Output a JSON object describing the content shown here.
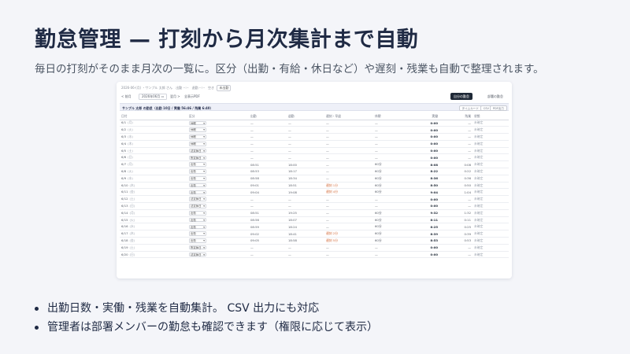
{
  "slide": {
    "title": "勤怠管理 — 打刻から月次集計まで自動",
    "subtitle": "毎日の打刻がそのまま月次の一覧に。区分（出勤・有給・休日など）や遅刻・残業も自動で整理されます。",
    "bullets": [
      "出勤日数・実働・残業を自動集計。 CSV 出力にも対応",
      "管理者は部署メンバーの勤怠も確認できます（権限に応じて表示）"
    ]
  },
  "screen": {
    "crumb": "2026-06-(月) ・サンプル 太郎 さん",
    "crumb_mid": "出勤 --:--　退勤 --:--　空き",
    "crumb_tag": "未出勤",
    "toolbar": {
      "prev": "< 前月",
      "month": "2026年06月",
      "next": "翌月 >",
      "pdf": "全表示PDF",
      "primary_button": "自分の勤怠",
      "secondary_button": "部署の勤怠"
    },
    "summary": {
      "text": "サンプル 太郎 の勤怠（出勤 10日 / 実働 56:46 / 残業 6:40）",
      "pills": [
        "タイムカード",
        "CSV",
        "PDF出力"
      ]
    },
    "columns": [
      "日付",
      "区分",
      "出勤",
      "退勤",
      "遅刻・早退",
      "休憩",
      "実働",
      "残業",
      "状態"
    ],
    "rows": [
      {
        "date": "6/1",
        "dow": "(月)",
        "kubun": "休暇",
        "in": "—",
        "out": "—",
        "pen": "—",
        "brk": "—",
        "work": "0:00",
        "ot": "—",
        "status": "未確定"
      },
      {
        "date": "6/2",
        "dow": "(火)",
        "kubun": "休暇",
        "in": "—",
        "out": "—",
        "pen": "—",
        "brk": "—",
        "work": "0:00",
        "ot": "—",
        "status": "未確定"
      },
      {
        "date": "6/3",
        "dow": "(水)",
        "kubun": "休暇",
        "in": "—",
        "out": "—",
        "pen": "—",
        "brk": "—",
        "work": "0:00",
        "ot": "—",
        "status": "未確定"
      },
      {
        "date": "6/4",
        "dow": "(木)",
        "kubun": "休暇",
        "in": "—",
        "out": "—",
        "pen": "—",
        "brk": "—",
        "work": "0:00",
        "ot": "—",
        "status": "未確定"
      },
      {
        "date": "6/5",
        "dow": "(土)",
        "kubun": "法定休日",
        "in": "—",
        "out": "—",
        "pen": "—",
        "brk": "—",
        "work": "0:00",
        "ot": "—",
        "status": "未確定"
      },
      {
        "date": "6/6",
        "dow": "(日)",
        "kubun": "所定休日",
        "in": "—",
        "out": "—",
        "pen": "—",
        "brk": "—",
        "work": "0:00",
        "ot": "—",
        "status": "未確定"
      },
      {
        "date": "6/7",
        "dow": "(月)",
        "kubun": "出勤",
        "in": "08:51",
        "out": "18:00",
        "pen": "—",
        "brk": "60分",
        "work": "8:08",
        "ot": "0:08",
        "status": "未確定"
      },
      {
        "date": "6/8",
        "dow": "(火)",
        "kubun": "出勤",
        "in": "08:53",
        "out": "18:17",
        "pen": "—",
        "brk": "60分",
        "work": "8:22",
        "ot": "0:22",
        "status": "未確定"
      },
      {
        "date": "6/9",
        "dow": "(水)",
        "kubun": "出勤",
        "in": "08:58",
        "out": "18:34",
        "pen": "—",
        "brk": "60分",
        "work": "8:36",
        "ot": "0:36",
        "status": "未確定"
      },
      {
        "date": "6/10",
        "dow": "(木)",
        "kubun": "出勤",
        "in": "09:01",
        "out": "18:51",
        "pen": "遅刻 1分",
        "brk": "60分",
        "work": "8:50",
        "ot": "0:50",
        "status": "未確定"
      },
      {
        "date": "6/11",
        "dow": "(金)",
        "kubun": "出勤",
        "in": "09:04",
        "out": "19:08",
        "pen": "遅刻 4分",
        "brk": "60分",
        "work": "9:04",
        "ot": "1:04",
        "status": "未確定"
      },
      {
        "date": "6/12",
        "dow": "(土)",
        "kubun": "法定休日",
        "in": "—",
        "out": "—",
        "pen": "—",
        "brk": "—",
        "work": "0:00",
        "ot": "—",
        "status": "未確定"
      },
      {
        "date": "6/13",
        "dow": "(日)",
        "kubun": "法定休日",
        "in": "—",
        "out": "—",
        "pen": "—",
        "brk": "—",
        "work": "0:00",
        "ot": "—",
        "status": "未確定"
      },
      {
        "date": "6/14",
        "dow": "(月)",
        "kubun": "出勤",
        "in": "08:51",
        "out": "19:25",
        "pen": "—",
        "brk": "60分",
        "work": "9:32",
        "ot": "1:32",
        "status": "未確定"
      },
      {
        "date": "6/15",
        "dow": "(火)",
        "kubun": "出勤",
        "in": "08:56",
        "out": "18:07",
        "pen": "—",
        "brk": "60分",
        "work": "8:11",
        "ot": "0:11",
        "status": "未確定"
      },
      {
        "date": "6/16",
        "dow": "(水)",
        "kubun": "出勤",
        "in": "08:59",
        "out": "18:24",
        "pen": "—",
        "brk": "60分",
        "work": "8:25",
        "ot": "0:25",
        "status": "未確定"
      },
      {
        "date": "6/17",
        "dow": "(木)",
        "kubun": "出勤",
        "in": "09:02",
        "out": "18:41",
        "pen": "遅刻 2分",
        "brk": "60分",
        "work": "8:39",
        "ot": "0:39",
        "status": "未確定"
      },
      {
        "date": "6/18",
        "dow": "(金)",
        "kubun": "出勤",
        "in": "09:05",
        "out": "18:58",
        "pen": "遅刻 5分",
        "brk": "60分",
        "work": "8:53",
        "ot": "0:53",
        "status": "未確定"
      },
      {
        "date": "6/19",
        "dow": "(土)",
        "kubun": "所定休日",
        "in": "—",
        "out": "—",
        "pen": "—",
        "brk": "—",
        "work": "0:00",
        "ot": "—",
        "status": "未確定"
      },
      {
        "date": "6/20",
        "dow": "(日)",
        "kubun": "法定休日",
        "in": "—",
        "out": "—",
        "pen": "—",
        "brk": "—",
        "work": "0:00",
        "ot": "—",
        "status": "未確定"
      }
    ]
  }
}
